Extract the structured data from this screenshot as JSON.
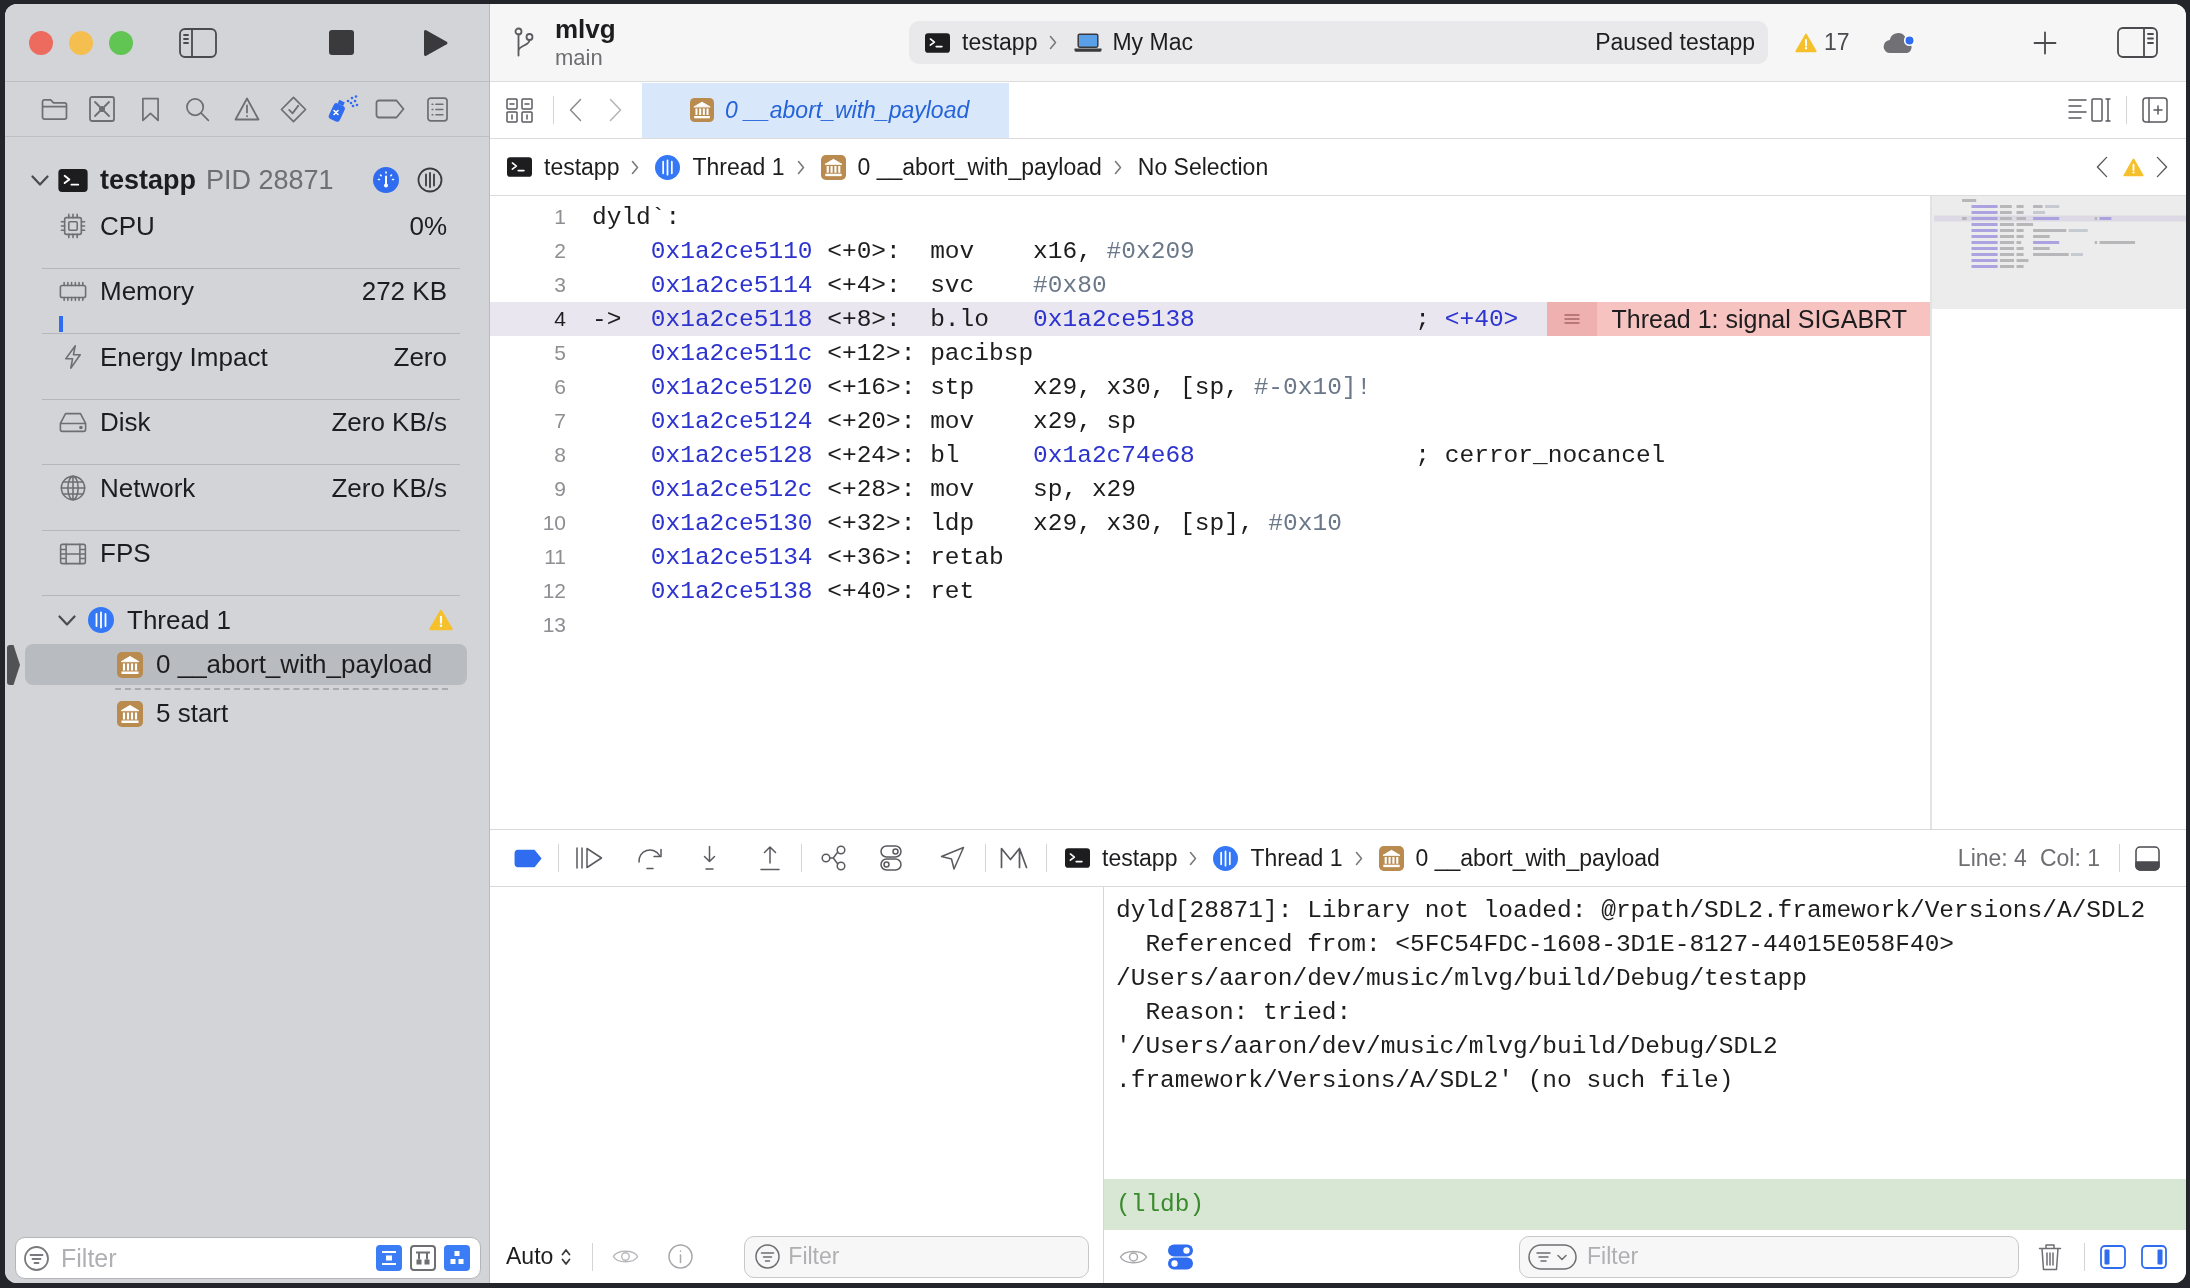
{
  "sidebar": {
    "navigator_tabs": [
      {
        "selected": false
      },
      {
        "selected": false
      },
      {
        "selected": false
      },
      {
        "selected": false
      },
      {
        "selected": false
      },
      {
        "selected": false
      },
      {
        "selected": true
      },
      {
        "selected": false
      },
      {
        "selected": false
      }
    ],
    "process": {
      "name": "testapp",
      "pid": "PID 28871",
      "expanded": true
    },
    "gauges": [
      {
        "kind": "cpu",
        "label": "CPU",
        "value": "0%"
      },
      {
        "kind": "memory",
        "label": "Memory",
        "value": "272 KB"
      },
      {
        "kind": "energy",
        "label": "Energy Impact",
        "value": "Zero"
      },
      {
        "kind": "disk",
        "label": "Disk",
        "value": "Zero KB/s"
      },
      {
        "kind": "network",
        "label": "Network",
        "value": "Zero KB/s"
      },
      {
        "kind": "fps",
        "label": "FPS"
      }
    ],
    "thread": {
      "name": "Thread 1",
      "expanded": true,
      "warning": true,
      "frames": [
        {
          "label": "0 __abort_with_payload",
          "selected": true,
          "gap_after": true
        },
        {
          "label": "5 start",
          "selected": false,
          "gap_after": false
        }
      ]
    },
    "filter": {
      "placeholder": "Filter",
      "toggles": [
        {
          "selected": true
        },
        {
          "selected": false
        },
        {
          "selected": true
        }
      ]
    }
  },
  "toolbar": {
    "project": "mlvg",
    "branch": "main",
    "scheme": "testapp",
    "destination": "My Mac",
    "status": "Paused testapp",
    "issues": "17"
  },
  "tabs": [
    {
      "label": "0 __abort_with_payload",
      "selected": true
    }
  ],
  "jump_bar": {
    "path": [
      {
        "kind": "target",
        "label": "testapp"
      },
      {
        "kind": "thread",
        "label": "Thread 1"
      },
      {
        "kind": "frame",
        "label": "0 __abort_with_payload"
      },
      {
        "kind": "none",
        "label": "No Selection"
      }
    ]
  },
  "editor": {
    "lines": [
      {
        "number": "1",
        "current": false,
        "label": "dyld`:"
      },
      {
        "number": "2",
        "current": false,
        "address": "0x1a2ce5110",
        "offset": "<+0>:",
        "mnemonic": "mov",
        "operands": [
          {
            "kind": "plain",
            "text": "x16,"
          },
          {
            "kind": "immediate",
            "text": "#0x209"
          }
        ]
      },
      {
        "number": "3",
        "current": false,
        "address": "0x1a2ce5114",
        "offset": "<+4>:",
        "mnemonic": "svc",
        "operands": [
          {
            "kind": "immediate",
            "text": "#0x80"
          }
        ]
      },
      {
        "number": "4",
        "current": true,
        "pc_arrow": "->",
        "address": "0x1a2ce5118",
        "offset": "<+8>:",
        "mnemonic": "b.lo",
        "operands": [
          {
            "kind": "address",
            "text": "0x1a2ce5138"
          }
        ],
        "comment": [
          {
            "kind": "plain",
            "text": ";"
          },
          {
            "kind": "address",
            "text": "<+40>"
          }
        ],
        "annotation": "Thread 1: signal SIGABRT"
      },
      {
        "number": "5",
        "current": false,
        "address": "0x1a2ce511c",
        "offset": "<+12>:",
        "mnemonic": "pacibsp"
      },
      {
        "number": "6",
        "current": false,
        "address": "0x1a2ce5120",
        "offset": "<+16>:",
        "mnemonic": "stp",
        "operands": [
          {
            "kind": "plain",
            "text": "x29, x30, [sp,"
          },
          {
            "kind": "immediate",
            "text": "#-0x10]!"
          }
        ]
      },
      {
        "number": "7",
        "current": false,
        "address": "0x1a2ce5124",
        "offset": "<+20>:",
        "mnemonic": "mov",
        "operands": [
          {
            "kind": "plain",
            "text": "x29, sp"
          }
        ]
      },
      {
        "number": "8",
        "current": false,
        "address": "0x1a2ce5128",
        "offset": "<+24>:",
        "mnemonic": "bl",
        "operands": [
          {
            "kind": "address",
            "text": "0x1a2c74e68"
          }
        ],
        "comment": [
          {
            "kind": "plain",
            "text": ";"
          },
          {
            "kind": "plain",
            "text": "cerror_nocancel"
          }
        ]
      },
      {
        "number": "9",
        "current": false,
        "address": "0x1a2ce512c",
        "offset": "<+28>:",
        "mnemonic": "mov",
        "operands": [
          {
            "kind": "plain",
            "text": "sp, x29"
          }
        ]
      },
      {
        "number": "10",
        "current": false,
        "address": "0x1a2ce5130",
        "offset": "<+32>:",
        "mnemonic": "ldp",
        "operands": [
          {
            "kind": "plain",
            "text": "x29, x30, [sp],"
          },
          {
            "kind": "immediate",
            "text": "#0x10"
          }
        ]
      },
      {
        "number": "11",
        "current": false,
        "address": "0x1a2ce5134",
        "offset": "<+36>:",
        "mnemonic": "retab"
      },
      {
        "number": "12",
        "current": false,
        "address": "0x1a2ce5138",
        "offset": "<+40>:",
        "mnemonic": "ret"
      },
      {
        "number": "13",
        "current": false
      }
    ]
  },
  "debug_bar": {
    "breakpoints_active": true,
    "path": [
      {
        "kind": "target",
        "label": "testapp"
      },
      {
        "kind": "thread",
        "label": "Thread 1"
      },
      {
        "kind": "frame",
        "label": "0 __abort_with_payload"
      }
    ],
    "line": "Line: 4",
    "column": "Col: 1"
  },
  "variables": {
    "scope": "Auto",
    "filter_placeholder": "Filter"
  },
  "console": {
    "output": [
      "dyld[28871]: Library not loaded: @rpath/SDL2.framework/Versions/A/SDL2",
      "  Referenced from: <5FC54FDC-1608-3D1E-8127-44015E058F40>",
      "/Users/aaron/dev/music/mlvg/build/Debug/testapp",
      "  Reason: tried:",
      "'/Users/aaron/dev/music/mlvg/build/Debug/SDL2",
      ".framework/Versions/A/SDL2' (no such file)"
    ],
    "prompt": "(lldb)",
    "filter_placeholder": "Filter",
    "panel_toggles": [
      {
        "selected": true
      },
      {
        "selected": true
      }
    ]
  }
}
